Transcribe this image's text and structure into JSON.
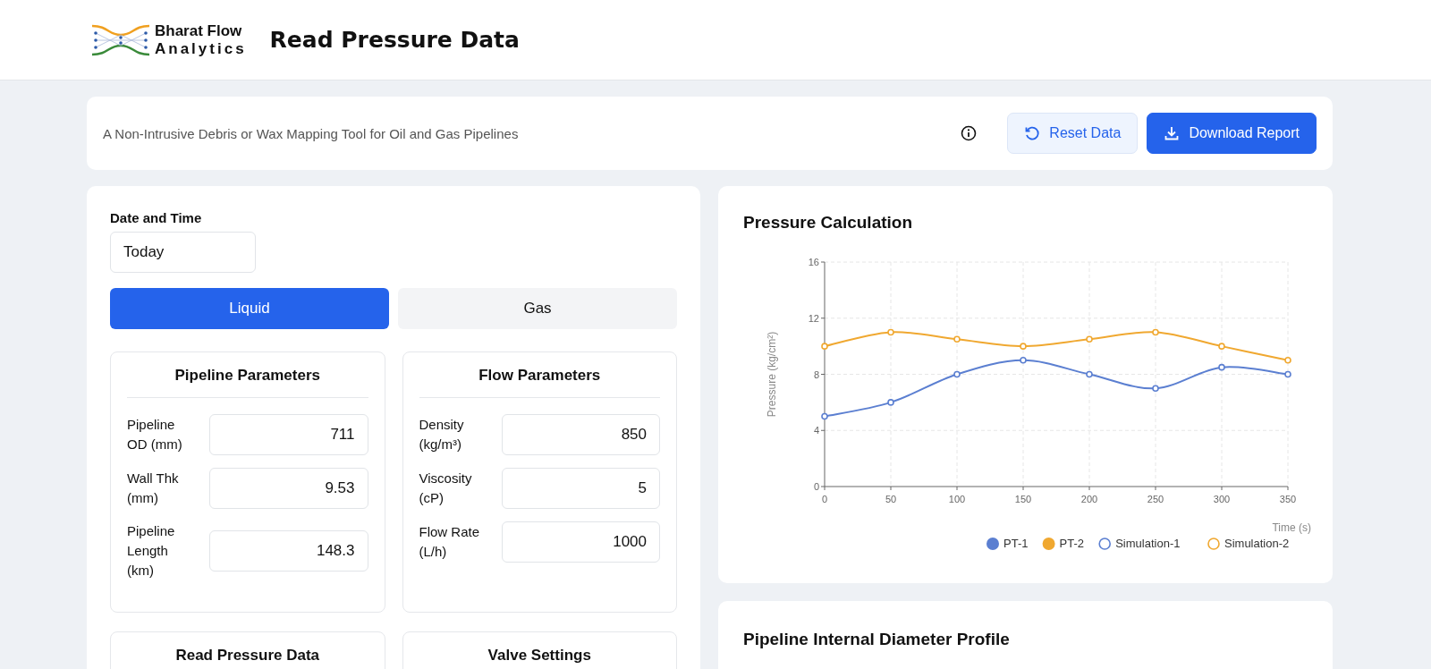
{
  "header": {
    "logo_line1": "Bharat Flow",
    "logo_line2": "Analytics",
    "title": "Read Pressure Data"
  },
  "info_bar": {
    "tagline": "A Non-Intrusive Debris or Wax Mapping Tool for Oil and Gas Pipelines",
    "buttons": [
      {
        "label": "Reset Data",
        "kind": "secondary"
      },
      {
        "label": "Download Report",
        "kind": "primary"
      }
    ]
  },
  "inputs_panel": {
    "date_label": "Date and Time",
    "date_value": "Today",
    "tabs": [
      {
        "label": "Liquid",
        "selected": true
      },
      {
        "label": "Gas",
        "selected": false
      }
    ],
    "sections": [
      {
        "title": "Pipeline Parameters",
        "fields": [
          {
            "label": "Pipeline OD (mm)",
            "value": "711"
          },
          {
            "label": "Wall Thk (mm)",
            "value": "9.53"
          },
          {
            "label": "Pipeline Length (km)",
            "value": "148.3"
          }
        ]
      },
      {
        "title": "Flow Parameters",
        "fields": [
          {
            "label": "Density (kg/m³)",
            "value": "850"
          },
          {
            "label": "Viscosity (cP)",
            "value": "5"
          },
          {
            "label": "Flow Rate (L/h)",
            "value": "1000"
          }
        ]
      },
      {
        "title": "Read Pressure Data"
      },
      {
        "title": "Valve Settings"
      }
    ]
  },
  "pressure_chart": {
    "title": "Pressure Calculation",
    "chart_data": {
      "type": "line",
      "xlabel": "Time (s)",
      "ylabel": "Pressure (kg/cm²)",
      "x": [
        0,
        50,
        100,
        150,
        200,
        250,
        300,
        350
      ],
      "series": [
        {
          "name": "PT-1",
          "color": "#5b7fd1",
          "marker": "circle",
          "values": [
            5,
            6,
            8,
            9,
            8,
            7,
            8.5,
            8
          ]
        },
        {
          "name": "PT-2",
          "color": "#f0a830",
          "marker": "circle",
          "values": [
            10,
            11,
            10.5,
            10,
            10.5,
            11,
            10,
            9
          ]
        },
        {
          "name": "Simulation-1",
          "color": "#5b7fd1",
          "values": [
            null,
            null,
            null,
            null,
            null,
            null,
            null,
            null
          ]
        },
        {
          "name": "Simulation-2",
          "color": "#f0a830",
          "values": [
            null,
            null,
            null,
            null,
            null,
            null,
            null,
            null
          ]
        }
      ],
      "xlim": [
        0,
        350
      ],
      "ylim": [
        0,
        16
      ],
      "xticks": [
        0,
        50,
        100,
        150,
        200,
        250,
        300,
        350
      ],
      "yticks": [
        0,
        4,
        8,
        12,
        16
      ],
      "grid": true,
      "legend": true
    }
  },
  "diameter_profile": {
    "title": "Pipeline Internal Diameter Profile"
  }
}
